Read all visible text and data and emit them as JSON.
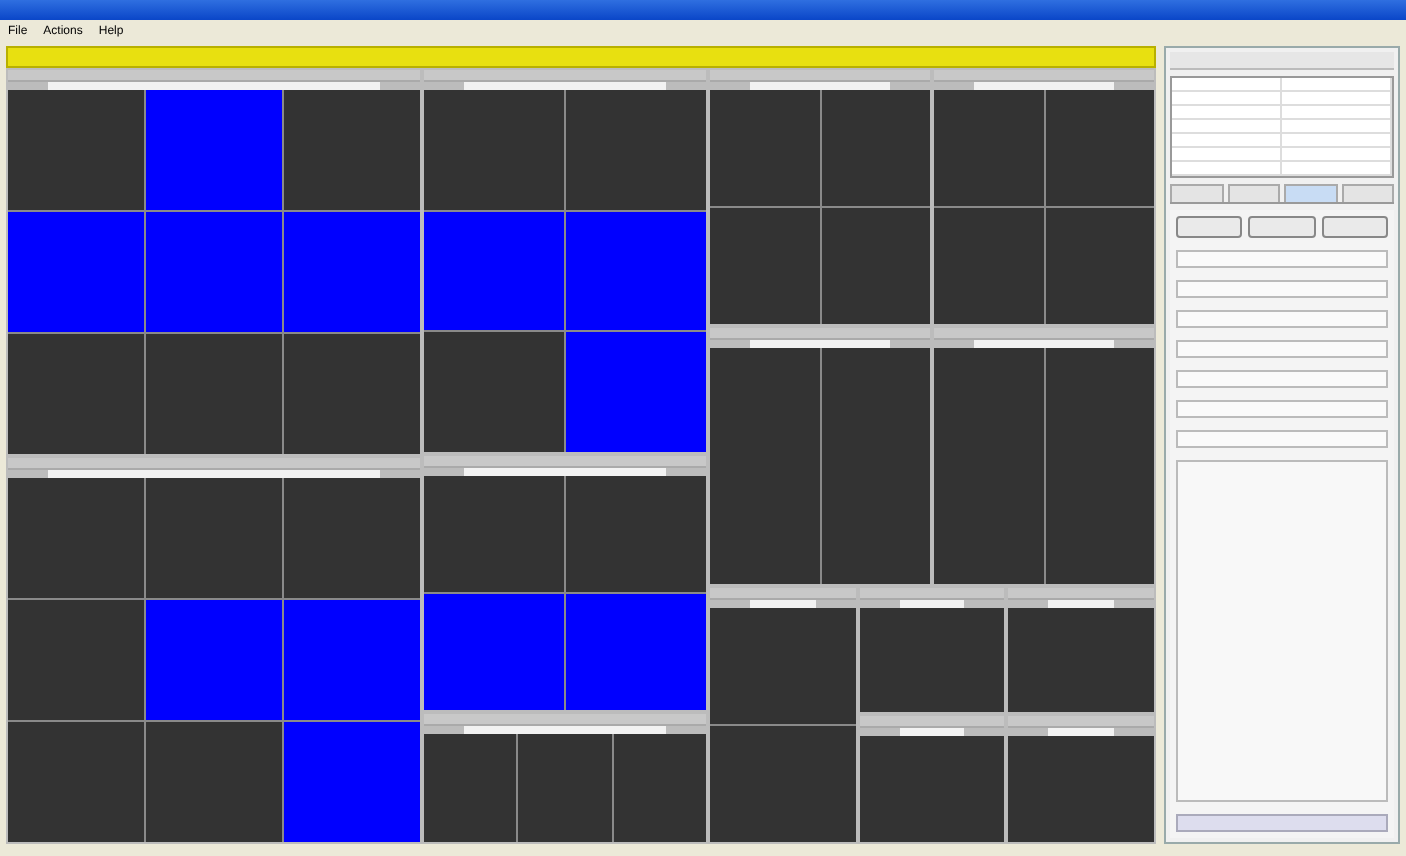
{
  "menu": [
    "File",
    "Actions",
    "Help"
  ],
  "treemap": {
    "columns": [
      {
        "groups": [
          {
            "rows": [
              [
                {
                  "highlighted": false
                },
                {
                  "highlighted": true
                },
                {
                  "highlighted": false
                }
              ],
              [
                {
                  "highlighted": true
                },
                {
                  "highlighted": true
                },
                {
                  "highlighted": true
                }
              ],
              [
                {
                  "highlighted": false
                },
                {
                  "highlighted": false
                },
                {
                  "highlighted": false
                }
              ]
            ]
          },
          {
            "rows": [
              [
                {
                  "highlighted": false
                },
                {
                  "highlighted": false
                },
                {
                  "highlighted": false
                }
              ],
              [
                {
                  "highlighted": false
                },
                {
                  "highlighted": true
                },
                {
                  "highlighted": true
                }
              ],
              [
                {
                  "highlighted": false
                },
                {
                  "highlighted": false
                },
                {
                  "highlighted": true
                }
              ]
            ]
          }
        ]
      },
      {
        "groups": [
          {
            "rows": [
              [
                {
                  "highlighted": false
                },
                {
                  "highlighted": false
                }
              ],
              [
                {
                  "highlighted": true
                },
                {
                  "highlighted": true
                }
              ],
              [
                {
                  "highlighted": false
                },
                {
                  "highlighted": true
                }
              ]
            ]
          },
          {
            "rows": [
              [
                {
                  "highlighted": false
                },
                {
                  "highlighted": false
                }
              ],
              [
                {
                  "highlighted": true
                },
                {
                  "highlighted": true
                }
              ]
            ]
          },
          {
            "rows": [
              [
                {
                  "highlighted": false
                },
                {
                  "highlighted": false
                },
                {
                  "highlighted": false
                }
              ]
            ]
          }
        ]
      },
      {
        "groups": [
          {
            "columns": [
              {
                "groups": [
                  {
                    "rows": [
                      [
                        {
                          "highlighted": false
                        },
                        {
                          "highlighted": false
                        }
                      ],
                      [
                        {
                          "highlighted": false
                        },
                        {
                          "highlighted": false
                        }
                      ]
                    ]
                  }
                ]
              },
              {
                "groups": [
                  {
                    "rows": [
                      [
                        {
                          "highlighted": false
                        },
                        {
                          "highlighted": false
                        }
                      ],
                      [
                        {
                          "highlighted": false
                        },
                        {
                          "highlighted": false
                        }
                      ]
                    ]
                  }
                ]
              }
            ]
          },
          {
            "columns": [
              {
                "groups": [
                  {
                    "rows": [
                      [
                        {
                          "highlighted": false
                        },
                        {
                          "highlighted": false
                        }
                      ]
                    ]
                  }
                ]
              },
              {
                "groups": [
                  {
                    "rows": [
                      [
                        {
                          "highlighted": false
                        },
                        {
                          "highlighted": false
                        }
                      ]
                    ]
                  }
                ]
              }
            ]
          },
          {
            "columns": [
              {
                "groups": [
                  {
                    "rows": [
                      [
                        {
                          "highlighted": false
                        }
                      ],
                      [
                        {
                          "highlighted": false
                        }
                      ]
                    ]
                  }
                ]
              },
              {
                "groups": [
                  {
                    "rows": [
                      [
                        {
                          "highlighted": false
                        }
                      ]
                    ]
                  },
                  {
                    "rows": [
                      [
                        {
                          "highlighted": false
                        }
                      ]
                    ]
                  }
                ]
              },
              {
                "groups": [
                  {
                    "rows": [
                      [
                        {
                          "highlighted": false
                        }
                      ]
                    ]
                  },
                  {
                    "rows": [
                      [
                        {
                          "highlighted": false
                        }
                      ]
                    ]
                  }
                ]
              }
            ]
          }
        ]
      }
    ]
  },
  "panel": {
    "tabs": [
      {
        "selected": false
      },
      {
        "selected": false
      },
      {
        "selected": true
      },
      {
        "selected": false
      }
    ],
    "controls": [
      {
        "kind": "button"
      },
      {
        "kind": "button"
      },
      {
        "kind": "button"
      },
      {
        "kind": "field"
      },
      {
        "kind": "field"
      },
      {
        "kind": "field"
      },
      {
        "kind": "field"
      },
      {
        "kind": "field"
      },
      {
        "kind": "field"
      },
      {
        "kind": "field"
      }
    ]
  }
}
